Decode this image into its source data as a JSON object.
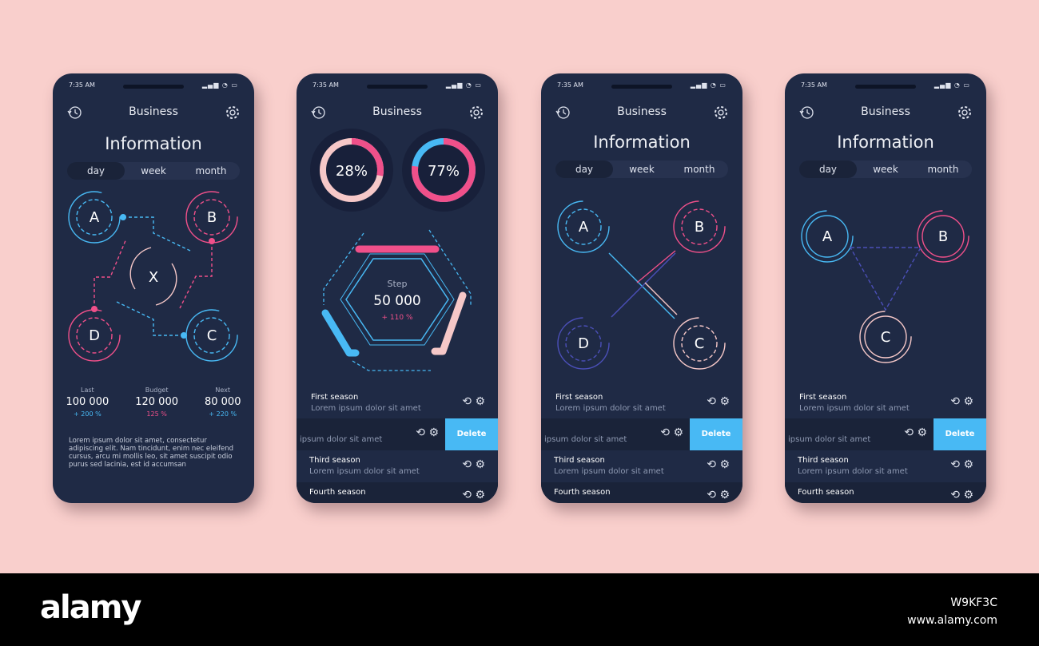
{
  "status": {
    "time": "7:35 AM"
  },
  "header": {
    "title": "Business",
    "history_icon": "history-icon",
    "settings_icon": "gear-icon"
  },
  "info_title": "Information",
  "tabs": [
    "day",
    "week",
    "month"
  ],
  "phone1": {
    "nodes": [
      "A",
      "B",
      "X",
      "D",
      "C"
    ],
    "stats": [
      {
        "label": "Last",
        "value": "100 000",
        "pct": "+ 200 %"
      },
      {
        "label": "Budget",
        "value": "120 000",
        "pct": "125 %"
      },
      {
        "label": "Next",
        "value": "80 000",
        "pct": "+ 220 %"
      }
    ],
    "lorem": "Lorem ipsum dolor sit amet, consectetur adipiscing elit. Nam tincidunt, enim nec eleifend cursus, arcu mi mollis leo, sit amet suscipit odio purus sed lacinia, est id accumsan"
  },
  "phone2": {
    "donuts": [
      {
        "label": "28%",
        "value": 28
      },
      {
        "label": "77%",
        "value": 77
      }
    ],
    "step_label": "Step",
    "step_value": "50 000",
    "step_pct": "+ 110 %"
  },
  "phone3": {
    "nodes": [
      "A",
      "B",
      "D",
      "C"
    ]
  },
  "phone4": {
    "nodes": [
      "A",
      "B",
      "C"
    ]
  },
  "list": {
    "first_title": "First season",
    "first_sub": "Lorem ipsum dolor sit amet",
    "second_sub": "ipsum dolor sit amet",
    "delete_label": "Delete",
    "third_title": "Third season",
    "third_sub": "Lorem ipsum dolor sit amet",
    "fourth_title": "Fourth season"
  },
  "colors": {
    "background": "#f9cfcc",
    "phone": "#1f2a45",
    "blue": "#48b9f4",
    "pink": "#f0508a",
    "light_pink": "#f6c8c8"
  },
  "footer": {
    "logo": "alamy",
    "code": "W9KF3C",
    "url": "www.alamy.com"
  }
}
